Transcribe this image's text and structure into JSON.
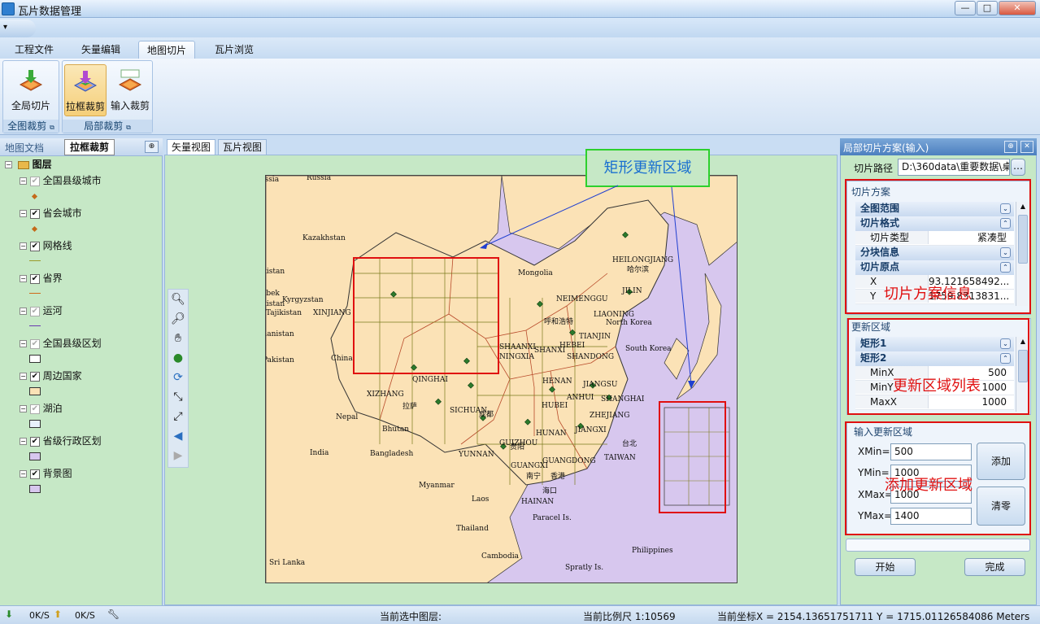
{
  "window": {
    "title": "瓦片数据管理",
    "min": "—",
    "max": "□",
    "close": "✕"
  },
  "qat": {
    "menu": "▾"
  },
  "ribbon": {
    "tabs": [
      {
        "label": "工程文件"
      },
      {
        "label": "矢量编辑"
      },
      {
        "label": "地图切片"
      },
      {
        "label": "瓦片浏览"
      }
    ],
    "groups": {
      "global": {
        "label": "全图裁剪",
        "buttons": [
          {
            "label": "全局切片"
          }
        ]
      },
      "local": {
        "label": "局部裁剪",
        "buttons": [
          {
            "label": "拉框裁剪"
          },
          {
            "label": "输入裁剪"
          }
        ]
      }
    }
  },
  "left_panel": {
    "title": "地图文档",
    "tooltip": "拉框裁剪",
    "root": "图层",
    "layers": [
      {
        "name": "全国县级城市",
        "checked": false,
        "symbol": "point"
      },
      {
        "name": "省会城市",
        "checked": true,
        "symbol": "point"
      },
      {
        "name": "网格线",
        "checked": true,
        "symbol": "line-olive"
      },
      {
        "name": "省界",
        "checked": true,
        "symbol": "line-orange"
      },
      {
        "name": "运河",
        "checked": false,
        "symbol": "line-purple"
      },
      {
        "name": "全国县级区划",
        "checked": false,
        "symbol": "fill-white"
      },
      {
        "name": "周边国家",
        "checked": true,
        "symbol": "fill-wheat"
      },
      {
        "name": "湖泊",
        "checked": false,
        "symbol": "fill-lightblue"
      },
      {
        "name": "省级行政区划",
        "checked": true,
        "symbol": "fill-lavender"
      },
      {
        "name": "背景图",
        "checked": true,
        "symbol": "fill-lavender"
      }
    ]
  },
  "map": {
    "tabs": [
      {
        "label": "矢量视图"
      },
      {
        "label": "瓦片视图"
      }
    ],
    "callout": "矩形更新区域",
    "labels": {
      "russia1": "Russia",
      "russia2": "Russia",
      "kazakhstan": "Kazakhstan",
      "mongolia": "Mongolia",
      "uzbekistan": "Uzbekistan",
      "uzb2": "Uzbek",
      "uzbekistan2": "Uzbekistan",
      "kyrgyzstan": "Kyrgyzstan",
      "tajikistan": "Tajikistan",
      "afghanistan": "Afghanistan",
      "pakistan": "Pakistan",
      "china": "China",
      "india": "India",
      "nepal": "Nepal",
      "bhutan": "Bhutan",
      "bangladesh": "Bangladesh",
      "myanmar": "Myanmar",
      "laos": "Laos",
      "thailand": "Thailand",
      "cambodia": "Cambodia",
      "srilanka": "Sri Lanka",
      "paracel": "Paracel Is.",
      "spratly": "Spratly Is.",
      "philippines": "Philippines",
      "northkorea": "North Korea",
      "southkorea": "South Korea",
      "xinjiang": "XINJIANG",
      "xizhang": "XIZHANG",
      "qinghai": "QINGHAI",
      "sichuan": "SICHUAN",
      "yunnan": "YUNNAN",
      "guizhou": "GUIZHOU",
      "guangxi": "GUANGXI",
      "guangdong": "GUANGDONG",
      "hainan": "HAINAN",
      "hunan": "HUNAN",
      "hubei": "HUBEI",
      "henan": "HENAN",
      "jiangxi": "JIANGXI",
      "zhejiang": "ZHEJIANG",
      "shanghai": "SHANGHAI",
      "jiangsu": "JIANGSU",
      "anhui": "ANHUI",
      "shandong": "SHANDONG",
      "hebei": "HEBEI",
      "tianjin": "TIANJIN",
      "shanxi": "SHANXI",
      "shaanxi": "SHAANXI",
      "ningxia": "NINGXIA",
      "neimenggu": "NEIMENGGU",
      "liaoning": "LIAONING",
      "jilin": "JILIN",
      "heilongjiang": "HEILONGJIANG",
      "taiwan": "TAIWAN",
      "taibei": "台北",
      "lasa": "拉萨",
      "haerbin": "哈尔滨",
      "huhehaote": "呼和浩特",
      "chengdu": "成都",
      "guiyang": "贵阳",
      "nanning": "南宁",
      "haikou": "海口",
      "xianggang": "香港"
    }
  },
  "right_panel": {
    "title": "局部切片方案(输入)",
    "path_label": "切片路径",
    "path_value": "D:\\360data\\重要数据\\桌",
    "path_browse": "…",
    "scheme": {
      "title": "切片方案",
      "rows": [
        {
          "type": "cat",
          "label": "全图范围",
          "icon": "⌄"
        },
        {
          "type": "cat",
          "label": "切片格式",
          "icon": "⌃"
        },
        {
          "type": "prop",
          "label": "切片类型",
          "value": "紧凑型"
        },
        {
          "type": "cat",
          "label": "分块信息",
          "icon": "⌄"
        },
        {
          "type": "cat",
          "label": "切片原点",
          "icon": "⌃"
        },
        {
          "type": "prop",
          "label": "X",
          "value": "93.121658492..."
        },
        {
          "type": "prop",
          "label": "Y",
          "value": "1759.8313831..."
        }
      ],
      "annotation": "切片方案信息"
    },
    "update": {
      "title": "更新区域",
      "rows": [
        {
          "type": "cat",
          "label": "矩形1",
          "icon": "⌄"
        },
        {
          "type": "cat",
          "label": "矩形2",
          "icon": "⌃"
        },
        {
          "type": "prop",
          "label": "MinX",
          "value": "500"
        },
        {
          "type": "prop",
          "label": "MinY",
          "value": "1000"
        },
        {
          "type": "prop",
          "label": "MaxX",
          "value": "1000"
        }
      ],
      "annotation": "更新区域列表"
    },
    "input": {
      "title": "输入更新区域",
      "fields": [
        {
          "label": "XMin=",
          "value": "500"
        },
        {
          "label": "YMin=",
          "value": "1000"
        },
        {
          "label": "XMax=",
          "value": "1000"
        },
        {
          "label": "YMax=",
          "value": "1400"
        }
      ],
      "add": "添加",
      "clear": "清零",
      "annotation": "添加更新区域"
    },
    "start": "开始",
    "finish": "完成"
  },
  "status": {
    "down": "0K/S",
    "up": "0K/S",
    "layer": "当前选中图层:",
    "scale": "当前比例尺 1:10569",
    "coords": "当前坐标X = 2154.13651751711 Y = 1715.01126584086 Meters"
  }
}
